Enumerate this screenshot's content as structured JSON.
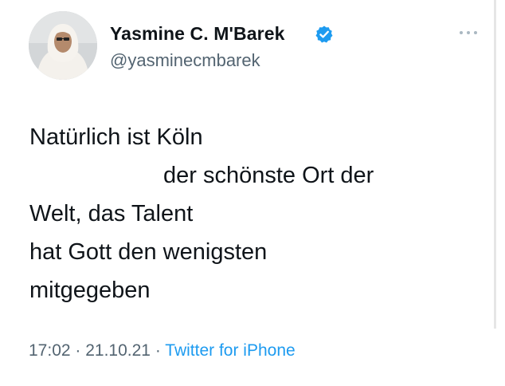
{
  "author": {
    "display_name": "Yasmine C. M'Barek",
    "handle": "@yasminecmbarek",
    "verified_icon": "verified-badge-icon",
    "verified_color": "#1d9bf0"
  },
  "tweet": {
    "lines": [
      "Natürlich ist Köln",
      "der schönste Ort der",
      "Welt, das Talent",
      "hat Gott den wenigsten",
      "mitgegeben"
    ]
  },
  "meta": {
    "time": "17:02",
    "separator1": " · ",
    "date": "21.10.21",
    "separator2": " · ",
    "source": "Twitter for iPhone"
  },
  "colors": {
    "text_primary": "#0f1419",
    "text_secondary": "#536471",
    "link": "#1d9bf0"
  },
  "icons": {
    "more": "more-options-icon"
  }
}
